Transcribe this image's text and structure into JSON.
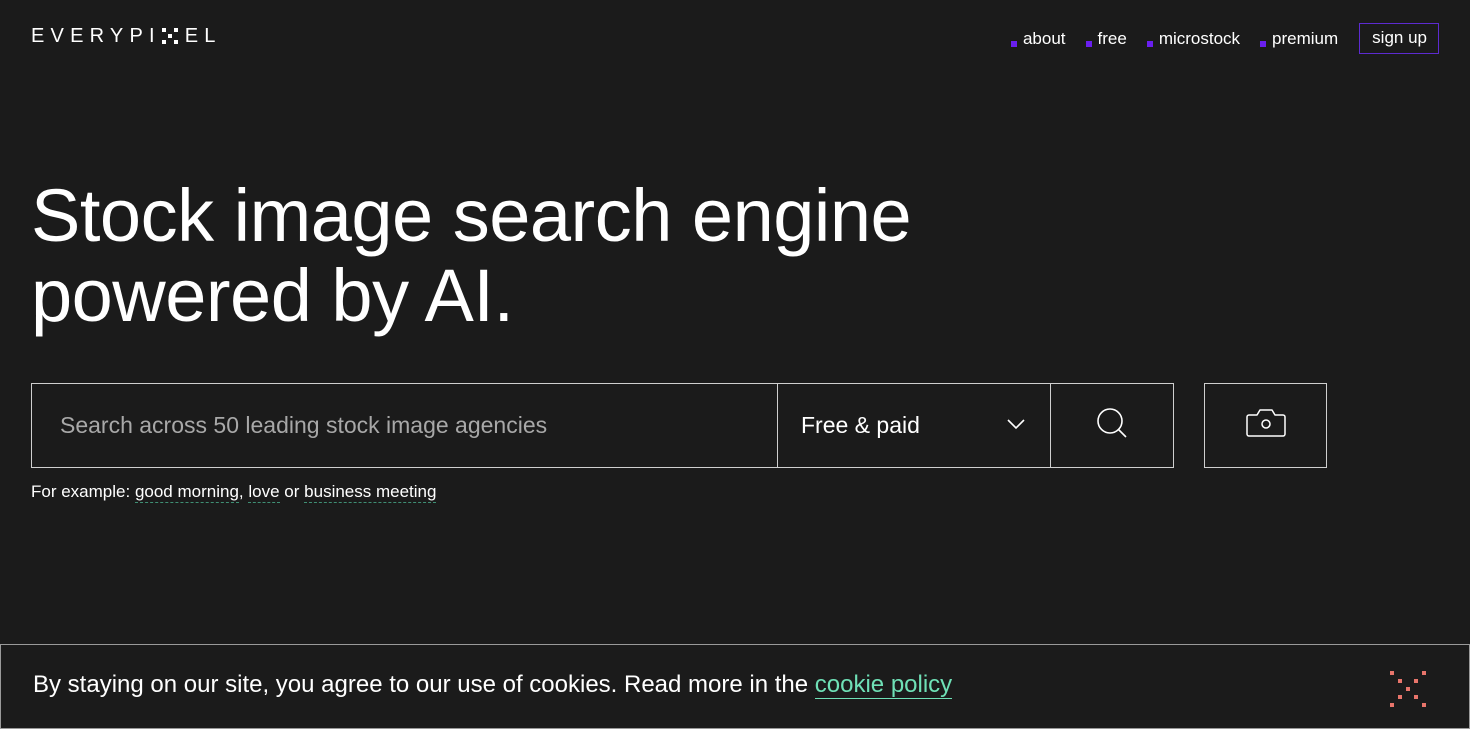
{
  "header": {
    "logo": {
      "left": "EVERYPI",
      "right": "EL"
    },
    "nav": [
      {
        "label": "about"
      },
      {
        "label": "free"
      },
      {
        "label": "microstock"
      },
      {
        "label": "premium"
      }
    ],
    "signup_label": "sign up"
  },
  "hero": {
    "line1": "Stock image search engine",
    "line2": "powered by AI."
  },
  "search": {
    "placeholder": "Search across 50 leading stock image agencies",
    "value": "",
    "filter_selected": "Free & paid",
    "icons": {
      "filter": "chevron-down-icon",
      "search": "search-icon",
      "camera": "camera-icon"
    }
  },
  "examples": {
    "prefix": "For example:",
    "items": [
      "good morning",
      "love",
      "business meeting"
    ],
    "sep1": ",",
    "sep2": "or"
  },
  "cookie": {
    "text": "By staying on our site, you agree to our use of cookies. Read more in the",
    "link": "cookie policy",
    "close_icon": "close-icon"
  },
  "colors": {
    "background": "#1b1b1b",
    "accent": "#6a1fef",
    "link": "#6fe0b6",
    "close": "#e8756b"
  }
}
